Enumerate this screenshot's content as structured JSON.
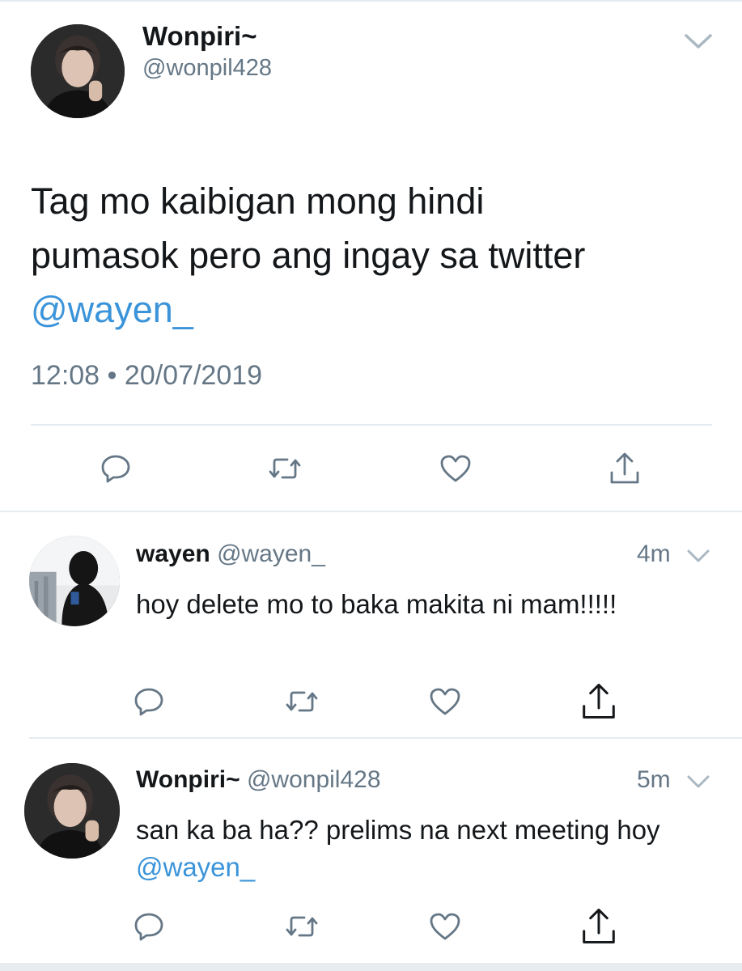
{
  "main_tweet": {
    "name": "Wonpiri~",
    "handle": "@wonpil428",
    "text_line1": "Tag mo kaibigan mong hindi",
    "text_line2": "pumasok pero ang ingay sa twitter",
    "mention": "@wayen_",
    "time": "12:08",
    "separator": "•",
    "date": "20/07/2019"
  },
  "replies": [
    {
      "name": "wayen",
      "handle": "@wayen_",
      "time": "4m",
      "text": "hoy delete mo to baka makita ni mam!!!!!"
    },
    {
      "name": "Wonpiri~",
      "handle": "@wonpil428",
      "time": "5m",
      "text": "san ka ba ha?? prelims na next meeting hoy ",
      "mention": "@wayen_"
    }
  ],
  "icons": [
    "chevron-down-icon",
    "reply-icon",
    "retweet-icon",
    "like-icon",
    "share-icon"
  ],
  "colors": {
    "text": "#14171a",
    "secondary": "#657786",
    "link": "#3b94d9",
    "divider": "#e6ecf0"
  }
}
